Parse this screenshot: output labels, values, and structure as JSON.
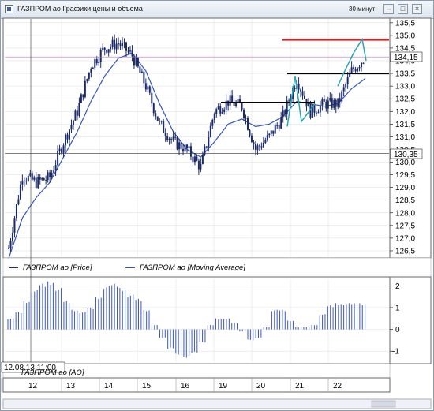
{
  "window": {
    "title": "ГАЗПРОМ ао Графики цены и объема",
    "interval": "30 минут",
    "buttons": {
      "minimize": "–",
      "maximize": "□",
      "close": "×"
    }
  },
  "legend": {
    "price": "ГАЗПРОМ ао [Price]",
    "ma": "ГАЗПРОМ ао [Moving Average]",
    "ao": "ГАЗПРОМ ао [AO]"
  },
  "crosshair": {
    "label": "12.08.13 11:00",
    "price": "130,35"
  },
  "last_price_label": "134,15",
  "colors": {
    "price": "#1a2a6a",
    "ma": "#3355bb",
    "ao_bars": "#3b57c9",
    "trend_line": "#2aa6b0",
    "resistance_red": "#e02020",
    "levels": "#000000"
  },
  "chart_data": [
    {
      "type": "line",
      "title": "",
      "series": [
        {
          "name": "ГАЗПРОМ ао [Price]",
          "style": "candles",
          "x": [
            "12.08 10:00",
            "12.08 13:00",
            "12.08 16:00",
            "13.08 10:00",
            "13.08 13:00",
            "13.08 16:00",
            "14.08 10:00",
            "14.08 13:00",
            "14.08 16:00",
            "15.08 10:00",
            "15.08 13:00",
            "15.08 16:00",
            "16.08 10:00",
            "16.08 13:00",
            "16.08 16:00",
            "19.08 10:00",
            "19.08 13:00",
            "19.08 16:00",
            "20.08 10:00",
            "20.08 13:00",
            "20.08 16:00",
            "21.08 10:00",
            "21.08 13:00",
            "21.08 16:00",
            "22.08 10:00",
            "22.08 13:00",
            "22.08 16:00"
          ],
          "y": [
            126.6,
            129.5,
            129.2,
            129.4,
            130.8,
            132.0,
            133.8,
            134.5,
            134.7,
            134.2,
            133.0,
            131.5,
            130.8,
            130.5,
            129.8,
            132.0,
            132.4,
            132.2,
            130.5,
            131.0,
            131.8,
            133.3,
            132.0,
            132.3,
            132.3,
            133.6,
            134.15
          ]
        },
        {
          "name": "ГАЗПРОМ ао [Moving Average]",
          "x": [
            "12.08 10:00",
            "12.08 13:00",
            "12.08 16:00",
            "13.08 10:00",
            "13.08 13:00",
            "13.08 16:00",
            "14.08 10:00",
            "14.08 13:00",
            "14.08 16:00",
            "15.08 10:00",
            "15.08 13:00",
            "15.08 16:00",
            "16.08 10:00",
            "16.08 13:00",
            "16.08 16:00",
            "19.08 10:00",
            "19.08 13:00",
            "19.08 16:00",
            "20.08 10:00",
            "20.08 13:00",
            "20.08 16:00",
            "21.08 10:00",
            "21.08 13:00",
            "21.08 16:00",
            "22.08 10:00",
            "22.08 13:00",
            "22.08 16:00"
          ],
          "y": [
            126.2,
            127.8,
            128.6,
            129.2,
            130.2,
            131.2,
            132.4,
            133.4,
            134.1,
            134.3,
            133.6,
            132.3,
            131.2,
            130.5,
            130.2,
            130.8,
            131.5,
            131.7,
            131.4,
            131.5,
            131.8,
            132.4,
            132.3,
            132.2,
            132.3,
            132.9,
            133.3
          ]
        }
      ],
      "categories": [
        "12",
        "13",
        "14",
        "15",
        "16",
        "19",
        "20",
        "21",
        "22"
      ],
      "ylim": [
        126.25,
        135.65
      ],
      "yticks": [
        "126,5",
        "127,0",
        "127,5",
        "128,0",
        "128,5",
        "129,0",
        "129,5",
        "130,0",
        "130,5",
        "131,0",
        "131,5",
        "132,0",
        "132,5",
        "133,0",
        "133,5",
        "134,0",
        "134,5",
        "135,0",
        "135,5"
      ],
      "levels": [
        {
          "name": "resistance",
          "y": 134.83,
          "color": "#e02020"
        },
        {
          "name": "level-upper",
          "y": 133.5
        },
        {
          "name": "level-lower",
          "y": 132.35
        },
        {
          "name": "crosshair",
          "y": 130.35
        }
      ],
      "grid": true
    },
    {
      "type": "bar",
      "title": "ГАЗПРОМ ао [AO]",
      "ylim": [
        -1.5,
        2.3
      ],
      "yticks": [
        "-1",
        "0",
        "1",
        "2"
      ],
      "values": [
        0.5,
        0.8,
        1.3,
        1.8,
        2.1,
        2.2,
        1.9,
        1.3,
        0.9,
        0.8,
        1.0,
        1.5,
        2.0,
        2.1,
        1.9,
        1.6,
        1.4,
        0.9,
        0.2,
        -0.4,
        -0.9,
        -1.2,
        -1.3,
        -1.1,
        -0.6,
        0.2,
        0.5,
        0.5,
        0.3,
        -0.1,
        -0.5,
        -0.4,
        0.1,
        0.9,
        0.9,
        0.4,
        0.1,
        0.1,
        0.2,
        0.7,
        1.1,
        1.2,
        1.2,
        1.2,
        1.2
      ]
    }
  ]
}
